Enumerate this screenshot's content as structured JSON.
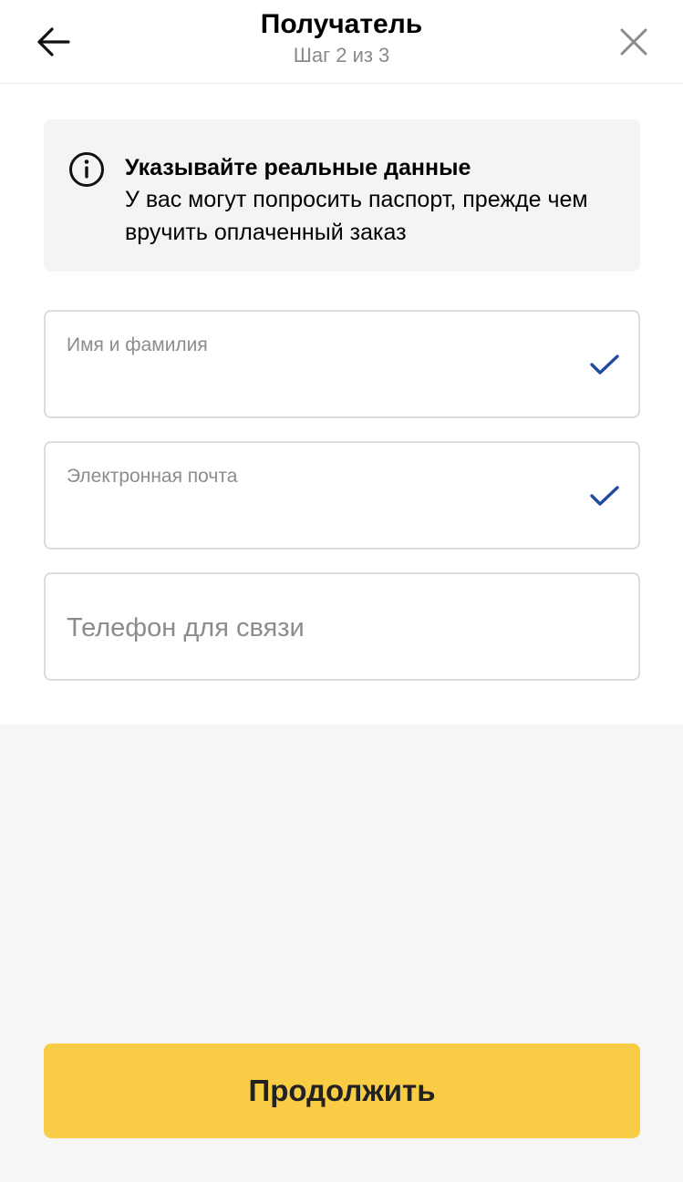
{
  "header": {
    "title": "Получатель",
    "subtitle": "Шаг 2 из 3"
  },
  "notice": {
    "icon": "info-icon",
    "title": "Указывайте реальные данные",
    "body": "У вас могут попросить паспорт, прежде чем вручить оплаченный заказ"
  },
  "form": {
    "name_field": {
      "label": "Имя и фамилия",
      "value": "",
      "status": "valid"
    },
    "email_field": {
      "label": "Электронная почта",
      "value": "",
      "status": "valid"
    },
    "phone_field": {
      "placeholder": "Телефон для связи",
      "value": ""
    }
  },
  "footer": {
    "continue_label": "Продолжить"
  },
  "colors": {
    "accent": "#f8cd45",
    "check": "#1f4a9e",
    "muted_text": "#8c8c8c",
    "border": "#dcdcdc"
  }
}
